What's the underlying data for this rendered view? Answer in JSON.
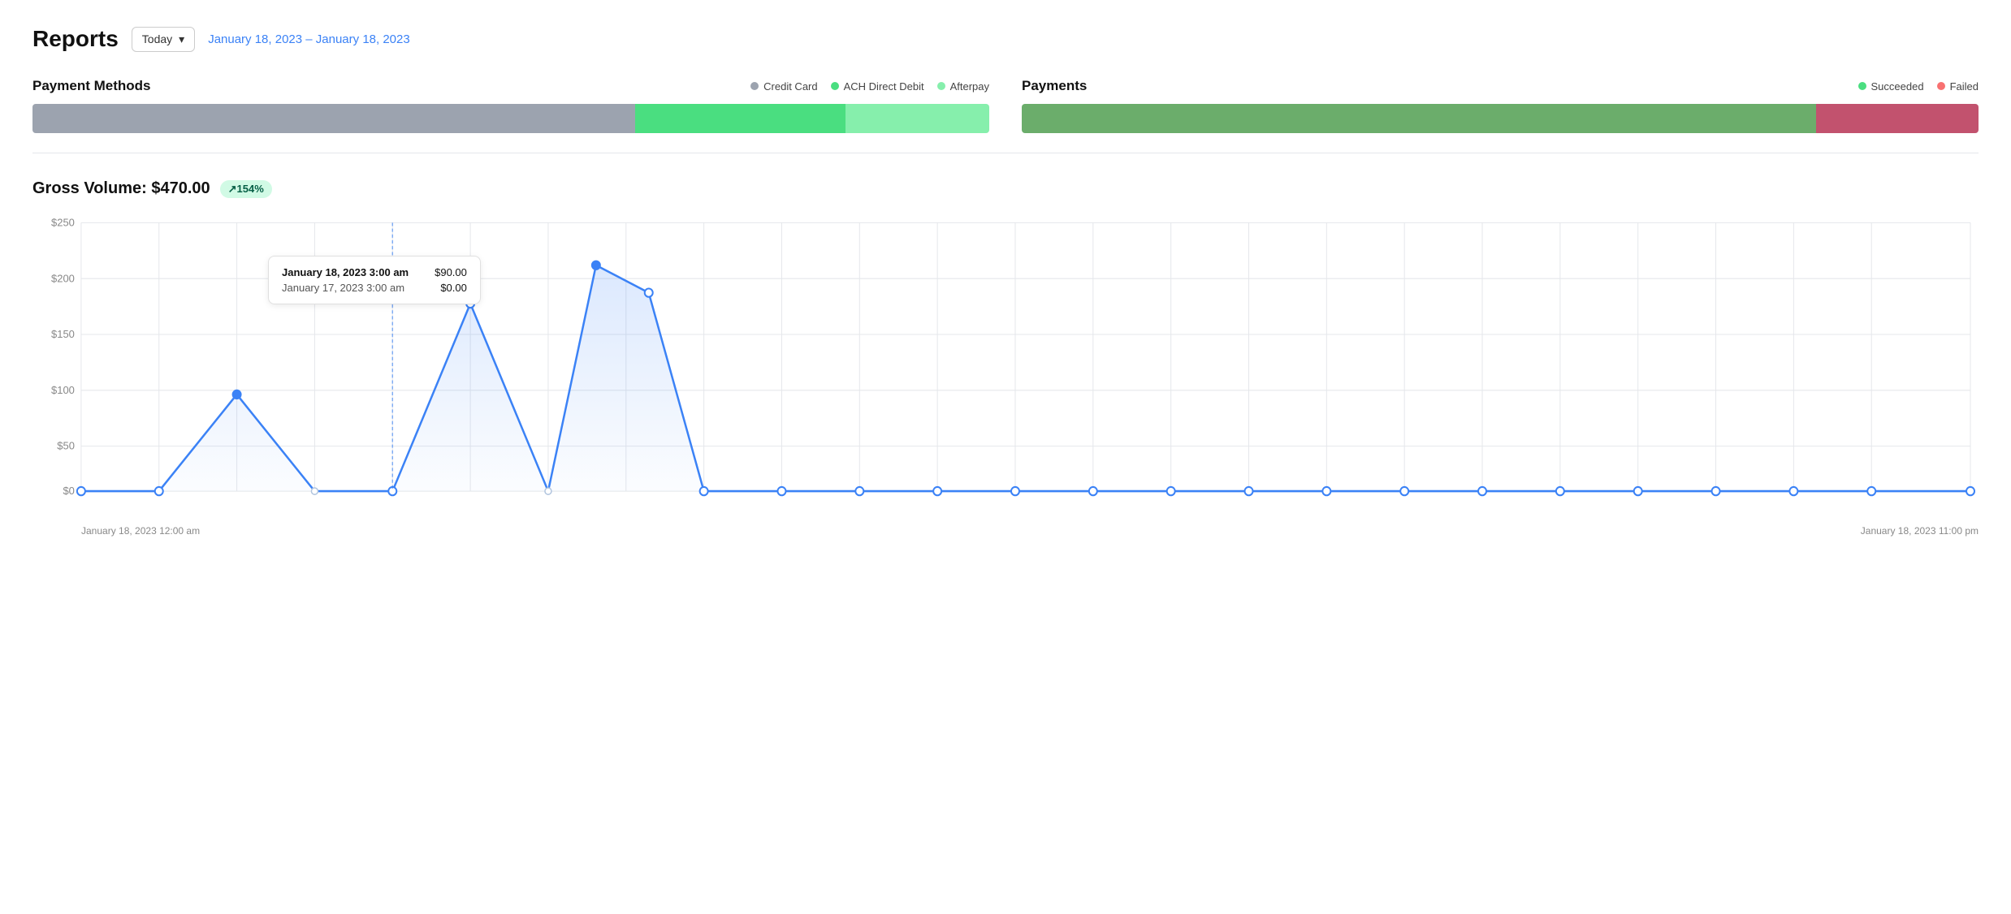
{
  "header": {
    "title": "Reports",
    "date_selector_label": "Today",
    "date_range": "January 18, 2023 – January 18, 2023"
  },
  "payment_methods": {
    "title": "Payment Methods",
    "legend": [
      {
        "label": "Credit Card",
        "color": "#9ca3af"
      },
      {
        "label": "ACH Direct Debit",
        "color": "#4ade80"
      },
      {
        "label": "Afterpay",
        "color": "#86efac"
      }
    ],
    "bar_segments": [
      {
        "label": "Credit Card",
        "color": "#9ca3af",
        "pct": 63
      },
      {
        "label": "ACH Direct Debit",
        "color": "#4ade80",
        "pct": 22
      },
      {
        "label": "Afterpay",
        "color": "#86efac",
        "pct": 15
      }
    ]
  },
  "payments": {
    "title": "Payments",
    "legend": [
      {
        "label": "Succeeded",
        "color": "#4ade80"
      },
      {
        "label": "Failed",
        "color": "#f87171"
      }
    ],
    "bar_segments": [
      {
        "label": "Succeeded",
        "color": "#6bad6b",
        "pct": 83
      },
      {
        "label": "Failed",
        "color": "#c2526e",
        "pct": 17
      }
    ]
  },
  "gross_volume": {
    "label": "Gross Volume:",
    "value": "$470.00",
    "badge": "↗154%"
  },
  "chart": {
    "y_labels": [
      "$250",
      "$200",
      "$150",
      "$100",
      "$50",
      "$0"
    ],
    "x_label_left": "January 18, 2023 12:00 am",
    "x_label_right": "January 18, 2023 11:00 pm"
  },
  "tooltip": {
    "row1_date": "January 18, 2023 3:00 am",
    "row1_value": "$90.00",
    "row2_date": "January 17, 2023 3:00 am",
    "row2_value": "$0.00"
  }
}
